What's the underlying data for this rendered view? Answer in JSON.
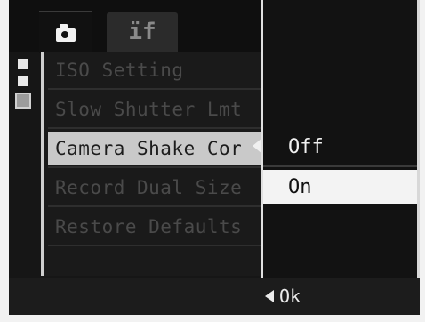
{
  "tabs": [
    {
      "icon": "camera-icon",
      "label": ""
    },
    {
      "icon": "setup-icon",
      "label": "ïf"
    }
  ],
  "menu": {
    "items": [
      {
        "label": "ISO Setting",
        "state": "dimmed"
      },
      {
        "label": "Slow Shutter Lmt",
        "state": "dimmed"
      },
      {
        "label": "Camera Shake Cor",
        "state": "selected"
      },
      {
        "label": "Record Dual Size",
        "state": "dimmed"
      },
      {
        "label": "Restore Defaults",
        "state": "dimmed"
      }
    ]
  },
  "options": [
    {
      "label": "Off",
      "selected": false
    },
    {
      "label": "On",
      "selected": true
    }
  ],
  "footer": {
    "ok_label": "Ok"
  },
  "colors": {
    "background": "#161616",
    "highlight": "#c9c9c9",
    "dimmed_text": "#4a4a4a",
    "option_highlight": "#f3f3f3"
  }
}
